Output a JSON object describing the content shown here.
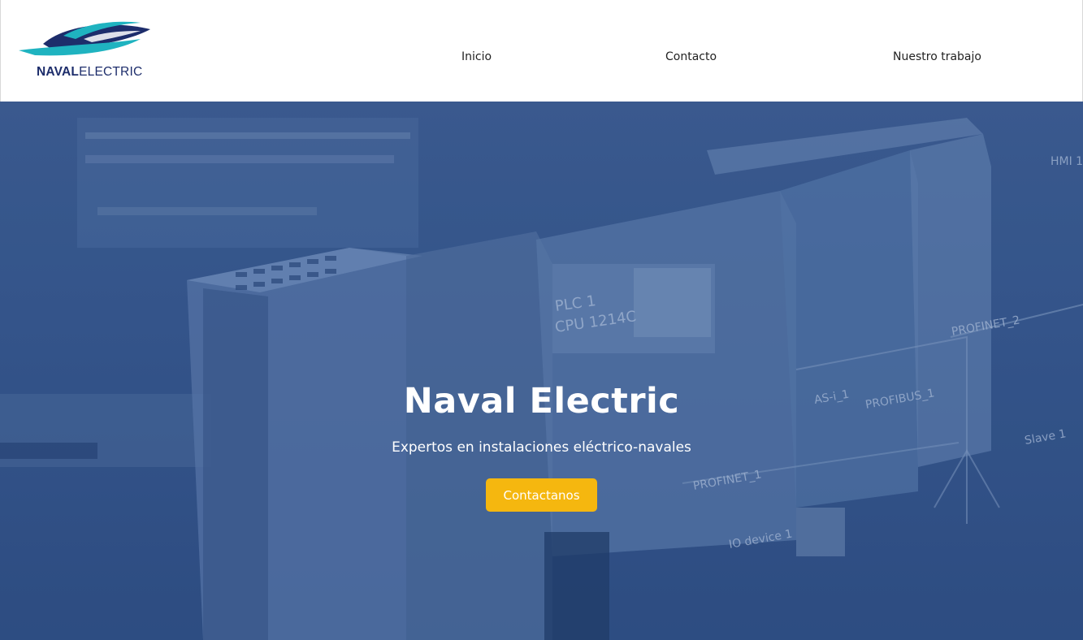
{
  "brand": {
    "logo_bold": "NAVAL",
    "logo_light": "ELECTRIC",
    "colors": {
      "navy": "#1d2d6b",
      "teal": "#1fb3c0"
    }
  },
  "nav": {
    "items": [
      {
        "label": "Inicio"
      },
      {
        "label": "Contacto"
      },
      {
        "label": "Nuestro trabajo"
      }
    ]
  },
  "hero": {
    "title": "Naval Electric",
    "subtitle": "Expertos en instalaciones eléctrico-navales",
    "cta_label": "Contactanos",
    "overlay_color": "#36568a",
    "cta_color": "#f5b70f",
    "image_labels": {
      "plc_model": "PLC 1",
      "cpu": "CPU 1214C",
      "profinet_1": "PROFINET_1",
      "profinet_2": "PROFINET_2",
      "profibus": "PROFIBUS_1",
      "asi": "AS-i_1",
      "hmi": "HMI 1",
      "slave": "Slave 1",
      "io_device": "IO device 1"
    }
  }
}
